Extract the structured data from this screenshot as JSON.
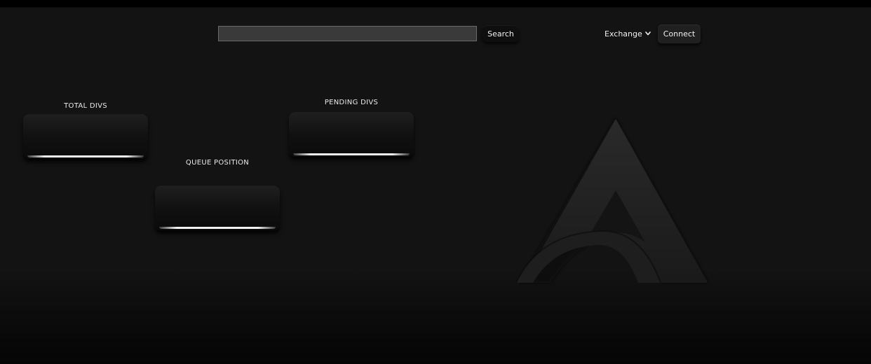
{
  "header": {
    "search": {
      "value": "",
      "placeholder": ""
    },
    "search_button_label": "Search",
    "exchange_menu_label": "Exchange",
    "connect_button_label": "Connect"
  },
  "cards": {
    "total_divs": {
      "label": "TOTAL DIVS",
      "value": ""
    },
    "queue_position": {
      "label": "QUEUE POSITION",
      "value": ""
    },
    "pending_divs": {
      "label": "PENDING DIVS",
      "value": ""
    }
  },
  "icons": {
    "chevron": "chevron-down-icon",
    "logo": "brand-logo-icon"
  },
  "colors": {
    "background": "#141314",
    "card": "#101010",
    "button": "#0e0e0e",
    "text": "#f2f2f2"
  }
}
